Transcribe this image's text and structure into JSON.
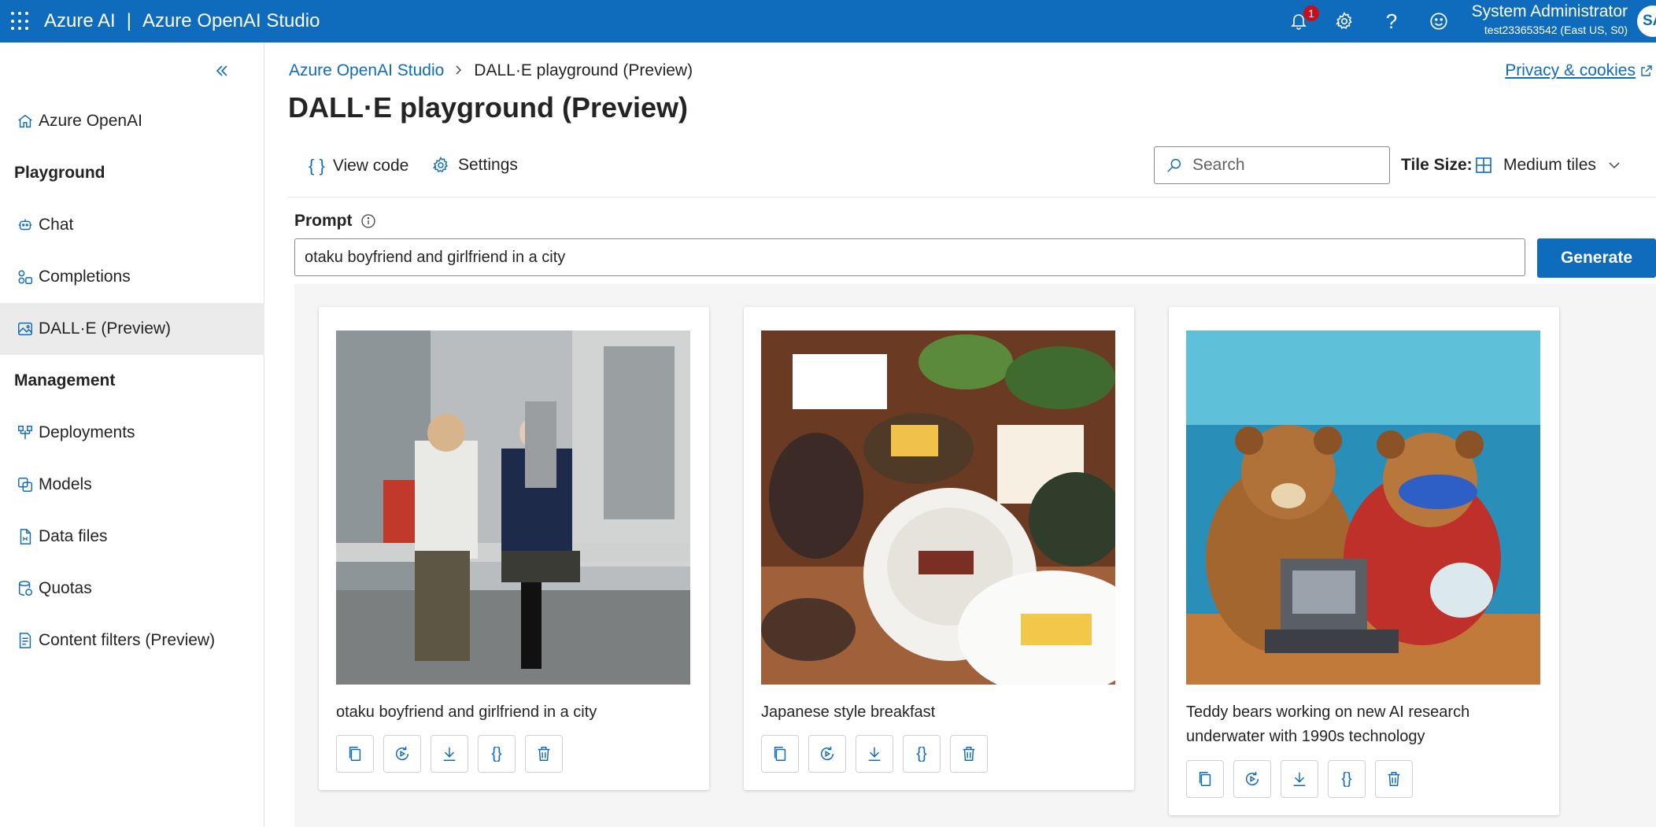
{
  "topbar": {
    "brand": "Azure AI",
    "separator": "|",
    "product": "Azure OpenAI Studio",
    "notification_count": "1",
    "user_name": "System Administrator",
    "user_sub": "test233653542 (East US, S0)",
    "avatar_initials": "SA"
  },
  "sidebar": {
    "items": [
      {
        "label": "Azure OpenAI",
        "icon": "home-icon"
      },
      {
        "label": "Chat",
        "icon": "chat-bot-icon"
      },
      {
        "label": "Completions",
        "icon": "completions-icon"
      },
      {
        "label": "DALL·E (Preview)",
        "icon": "image-icon",
        "active": true
      },
      {
        "label": "Deployments",
        "icon": "deployments-icon"
      },
      {
        "label": "Models",
        "icon": "models-icon"
      },
      {
        "label": "Data files",
        "icon": "document-icon"
      },
      {
        "label": "Quotas",
        "icon": "database-icon"
      },
      {
        "label": "Content filters (Preview)",
        "icon": "content-filter-icon"
      }
    ],
    "sections": {
      "playground": "Playground",
      "management": "Management"
    }
  },
  "breadcrumb": {
    "root": "Azure OpenAI Studio",
    "current": "DALL·E playground (Preview)"
  },
  "privacy_link": "Privacy & cookies",
  "page_title": "DALL·E playground (Preview)",
  "toolbar": {
    "view_code": "View code",
    "settings": "Settings",
    "search_placeholder": "Search",
    "tile_size_label": "Tile Size:",
    "tile_size_value": "Medium tiles"
  },
  "prompt": {
    "label": "Prompt",
    "value": "otaku boyfriend and girlfriend in a city",
    "generate_label": "Generate"
  },
  "cards": [
    {
      "caption": "otaku boyfriend and girlfriend in a city"
    },
    {
      "caption": "Japanese style breakfast"
    },
    {
      "caption": "Teddy bears working on new AI research underwater with 1990s technology"
    }
  ],
  "colors": {
    "brand_blue": "#0f6cbd",
    "badge_red": "#c50f1f"
  }
}
